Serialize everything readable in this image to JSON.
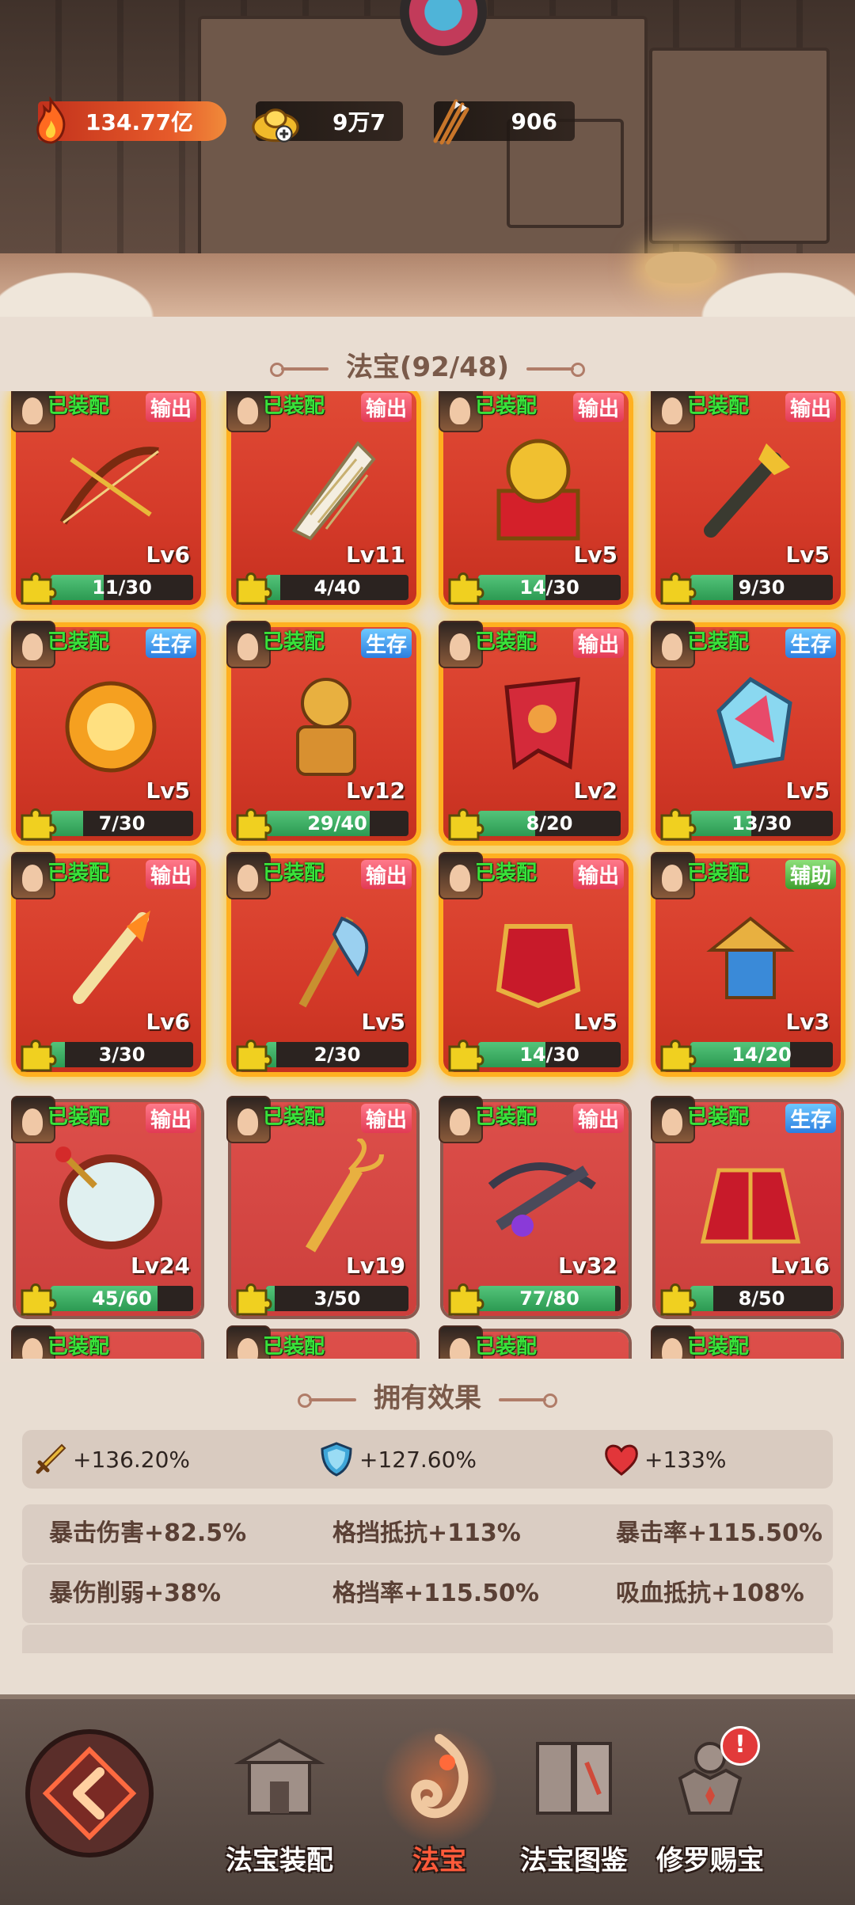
{
  "header": {
    "resources": [
      {
        "name": "power",
        "value": "134.77亿",
        "icon": "flame-icon"
      },
      {
        "name": "gold-ingot",
        "value": "9万7",
        "icon": "gold-ingot-icon"
      },
      {
        "name": "arrows",
        "value": "906",
        "icon": "arrows-icon"
      }
    ]
  },
  "treasures": {
    "title": "法宝(92/48)",
    "items": [
      {
        "equipped": "已装配",
        "role": "输出",
        "role_type": "out",
        "level": "Lv6",
        "progress": "11/30",
        "fill": 0.37,
        "glow": true,
        "art": "bow"
      },
      {
        "equipped": "已装配",
        "role": "输出",
        "role_type": "out",
        "level": "Lv11",
        "progress": "4/40",
        "fill": 0.1,
        "glow": true,
        "art": "harp"
      },
      {
        "equipped": "已装配",
        "role": "输出",
        "role_type": "out",
        "level": "Lv5",
        "progress": "14/30",
        "fill": 0.47,
        "glow": true,
        "art": "lion"
      },
      {
        "equipped": "已装配",
        "role": "输出",
        "role_type": "out",
        "level": "Lv5",
        "progress": "9/30",
        "fill": 0.3,
        "glow": true,
        "art": "mace"
      },
      {
        "equipped": "已装配",
        "role": "生存",
        "role_type": "live",
        "level": "Lv5",
        "progress": "7/30",
        "fill": 0.23,
        "glow": true,
        "art": "orb"
      },
      {
        "equipped": "已装配",
        "role": "生存",
        "role_type": "live",
        "level": "Lv12",
        "progress": "29/40",
        "fill": 0.73,
        "glow": true,
        "art": "statue"
      },
      {
        "equipped": "已装配",
        "role": "输出",
        "role_type": "out",
        "level": "Lv2",
        "progress": "8/20",
        "fill": 0.4,
        "glow": true,
        "art": "banner"
      },
      {
        "equipped": "已装配",
        "role": "生存",
        "role_type": "live",
        "level": "Lv5",
        "progress": "13/30",
        "fill": 0.43,
        "glow": true,
        "art": "gem"
      },
      {
        "equipped": "已装配",
        "role": "输出",
        "role_type": "out",
        "level": "Lv6",
        "progress": "3/30",
        "fill": 0.1,
        "glow": true,
        "art": "sword"
      },
      {
        "equipped": "已装配",
        "role": "输出",
        "role_type": "out",
        "level": "Lv5",
        "progress": "2/30",
        "fill": 0.07,
        "glow": true,
        "art": "axe"
      },
      {
        "equipped": "已装配",
        "role": "输出",
        "role_type": "out",
        "level": "Lv5",
        "progress": "14/30",
        "fill": 0.47,
        "glow": true,
        "art": "armor"
      },
      {
        "equipped": "已装配",
        "role": "辅助",
        "role_type": "aid",
        "level": "Lv3",
        "progress": "14/20",
        "fill": 0.7,
        "glow": true,
        "art": "pagoda"
      },
      {
        "equipped": "已装配",
        "role": "输出",
        "role_type": "out",
        "level": "Lv24",
        "progress": "45/60",
        "fill": 0.75,
        "glow": false,
        "art": "drum"
      },
      {
        "equipped": "已装配",
        "role": "输出",
        "role_type": "out",
        "level": "Lv19",
        "progress": "3/50",
        "fill": 0.06,
        "glow": false,
        "art": "vajra"
      },
      {
        "equipped": "已装配",
        "role": "输出",
        "role_type": "out",
        "level": "Lv32",
        "progress": "77/80",
        "fill": 0.96,
        "glow": false,
        "art": "crossbow"
      },
      {
        "equipped": "已装配",
        "role": "生存",
        "role_type": "live",
        "level": "Lv16",
        "progress": "8/50",
        "fill": 0.16,
        "glow": false,
        "art": "robe"
      },
      {
        "equipped": "已装配",
        "role": "",
        "role_type": "out",
        "level": "",
        "progress": "",
        "fill": 0,
        "glow": false,
        "art": "none"
      },
      {
        "equipped": "已装配",
        "role": "",
        "role_type": "out",
        "level": "",
        "progress": "",
        "fill": 0,
        "glow": false,
        "art": "none"
      },
      {
        "equipped": "已装配",
        "role": "",
        "role_type": "out",
        "level": "",
        "progress": "",
        "fill": 0,
        "glow": false,
        "art": "none"
      },
      {
        "equipped": "已装配",
        "role": "",
        "role_type": "out",
        "level": "",
        "progress": "",
        "fill": 0,
        "glow": false,
        "art": "none"
      }
    ]
  },
  "effects": {
    "title": "拥有效果",
    "main": [
      {
        "icon": "sword-icon",
        "value": "+136.20%"
      },
      {
        "icon": "shield-icon",
        "value": "+127.60%"
      },
      {
        "icon": "heart-icon",
        "value": "+133%"
      }
    ],
    "rows": [
      [
        "暴击伤害+82.5%",
        "格挡抵抗+113%",
        "暴击率+115.50%"
      ],
      [
        "暴伤削弱+38%",
        "格挡率+115.50%",
        "吸血抵抗+108%"
      ],
      [
        "",
        "",
        ""
      ]
    ]
  },
  "nav": {
    "tabs": [
      {
        "label": "法宝装配",
        "icon": "temple-icon"
      },
      {
        "label": "法宝",
        "icon": "flame-swirl-icon"
      },
      {
        "label": "法宝图鉴",
        "icon": "book-icon"
      },
      {
        "label": "修罗赐宝",
        "icon": "asura-statue-icon"
      }
    ],
    "badge": "!"
  },
  "colors": {
    "accent": "#ff5a3a",
    "equipped": "#39e23a",
    "card": "#d43a29",
    "glow": "#ffb020"
  }
}
